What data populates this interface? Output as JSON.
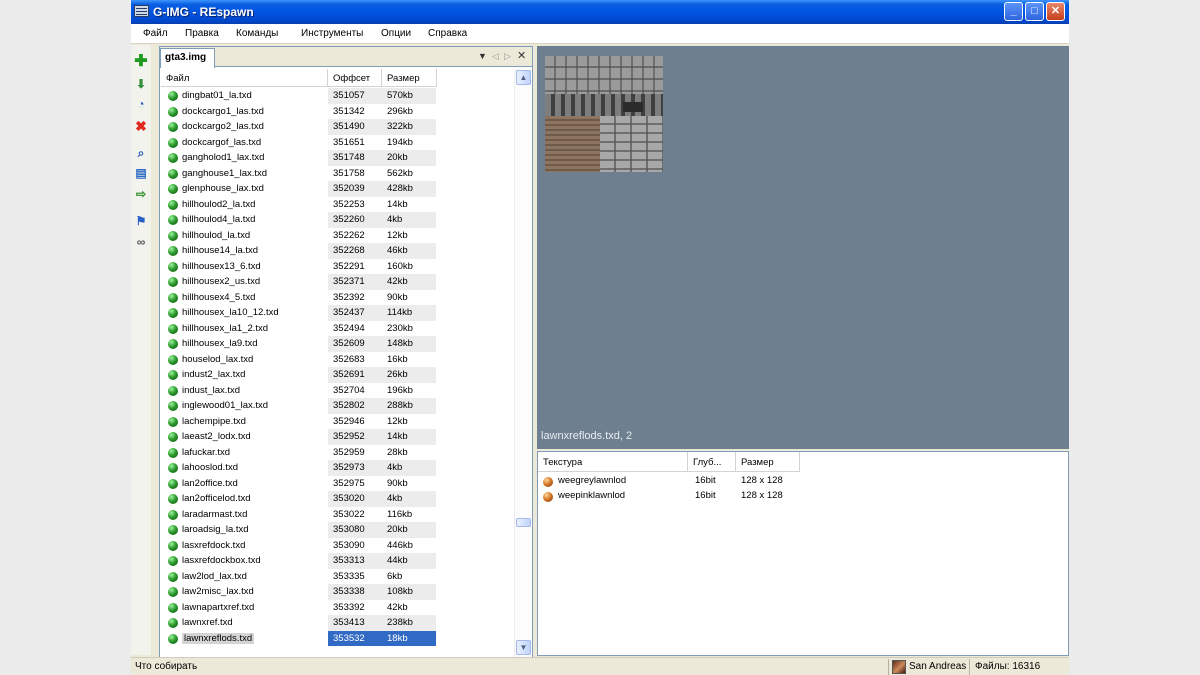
{
  "window": {
    "title": "G-IMG - REspawn"
  },
  "menubar": [
    "Файл",
    "Правка",
    "Команды",
    "Инструменты",
    "Опции",
    "Справка"
  ],
  "toolbar": {
    "icons": [
      "add-icon",
      "import-icon",
      "stopwatch-icon",
      "delete-icon",
      "search-icon",
      "rebuild-icon",
      "export-icon",
      "flag-icon",
      "link-icon"
    ]
  },
  "file_panel": {
    "tab_label": "gta3.img",
    "columns": [
      "Файл",
      "Оффсет",
      "Размер"
    ],
    "rows": [
      {
        "name": "dingbat01_la.txd",
        "offset": "351057",
        "size": "570kb"
      },
      {
        "name": "dockcargo1_las.txd",
        "offset": "351342",
        "size": "296kb"
      },
      {
        "name": "dockcargo2_las.txd",
        "offset": "351490",
        "size": "322kb"
      },
      {
        "name": "dockcargof_las.txd",
        "offset": "351651",
        "size": "194kb"
      },
      {
        "name": "gangholod1_lax.txd",
        "offset": "351748",
        "size": "20kb"
      },
      {
        "name": "ganghouse1_lax.txd",
        "offset": "351758",
        "size": "562kb"
      },
      {
        "name": "glenphouse_lax.txd",
        "offset": "352039",
        "size": "428kb"
      },
      {
        "name": "hillhoulod2_la.txd",
        "offset": "352253",
        "size": "14kb"
      },
      {
        "name": "hillhoulod4_la.txd",
        "offset": "352260",
        "size": "4kb"
      },
      {
        "name": "hillhoulod_la.txd",
        "offset": "352262",
        "size": "12kb"
      },
      {
        "name": "hillhouse14_la.txd",
        "offset": "352268",
        "size": "46kb"
      },
      {
        "name": "hillhousex13_6.txd",
        "offset": "352291",
        "size": "160kb"
      },
      {
        "name": "hillhousex2_us.txd",
        "offset": "352371",
        "size": "42kb"
      },
      {
        "name": "hillhousex4_5.txd",
        "offset": "352392",
        "size": "90kb"
      },
      {
        "name": "hillhousex_la10_12.txd",
        "offset": "352437",
        "size": "114kb"
      },
      {
        "name": "hillhousex_la1_2.txd",
        "offset": "352494",
        "size": "230kb"
      },
      {
        "name": "hillhousex_la9.txd",
        "offset": "352609",
        "size": "148kb"
      },
      {
        "name": "houselod_lax.txd",
        "offset": "352683",
        "size": "16kb"
      },
      {
        "name": "indust2_lax.txd",
        "offset": "352691",
        "size": "26kb"
      },
      {
        "name": "indust_lax.txd",
        "offset": "352704",
        "size": "196kb"
      },
      {
        "name": "inglewood01_lax.txd",
        "offset": "352802",
        "size": "288kb"
      },
      {
        "name": "lachempipe.txd",
        "offset": "352946",
        "size": "12kb"
      },
      {
        "name": "laeast2_lodx.txd",
        "offset": "352952",
        "size": "14kb"
      },
      {
        "name": "lafuckar.txd",
        "offset": "352959",
        "size": "28kb"
      },
      {
        "name": "lahooslod.txd",
        "offset": "352973",
        "size": "4kb"
      },
      {
        "name": "lan2office.txd",
        "offset": "352975",
        "size": "90kb"
      },
      {
        "name": "lan2officelod.txd",
        "offset": "353020",
        "size": "4kb"
      },
      {
        "name": "laradarmast.txd",
        "offset": "353022",
        "size": "116kb"
      },
      {
        "name": "laroadsig_la.txd",
        "offset": "353080",
        "size": "20kb"
      },
      {
        "name": "lasxrefdock.txd",
        "offset": "353090",
        "size": "446kb"
      },
      {
        "name": "lasxrefdockbox.txd",
        "offset": "353313",
        "size": "44kb"
      },
      {
        "name": "law2lod_lax.txd",
        "offset": "353335",
        "size": "6kb"
      },
      {
        "name": "law2misc_lax.txd",
        "offset": "353338",
        "size": "108kb"
      },
      {
        "name": "lawnapartxref.txd",
        "offset": "353392",
        "size": "42kb"
      },
      {
        "name": "lawnxref.txd",
        "offset": "353413",
        "size": "238kb"
      },
      {
        "name": "lawnxreflods.txd",
        "offset": "353532",
        "size": "18kb"
      }
    ],
    "selected_index": 35
  },
  "preview": {
    "caption": "lawnxreflods.txd, 2"
  },
  "texture_panel": {
    "columns": [
      "Текстура",
      "Глуб...",
      "Размер"
    ],
    "rows": [
      {
        "name": "weegreylawnlod",
        "depth": "16bit",
        "size": "128 x 128"
      },
      {
        "name": "weepinklawnlod",
        "depth": "16bit",
        "size": "128 x 128"
      }
    ]
  },
  "statusbar": {
    "left": "Что собирать",
    "game": "San Andreas",
    "files": "Файлы: 16316"
  }
}
